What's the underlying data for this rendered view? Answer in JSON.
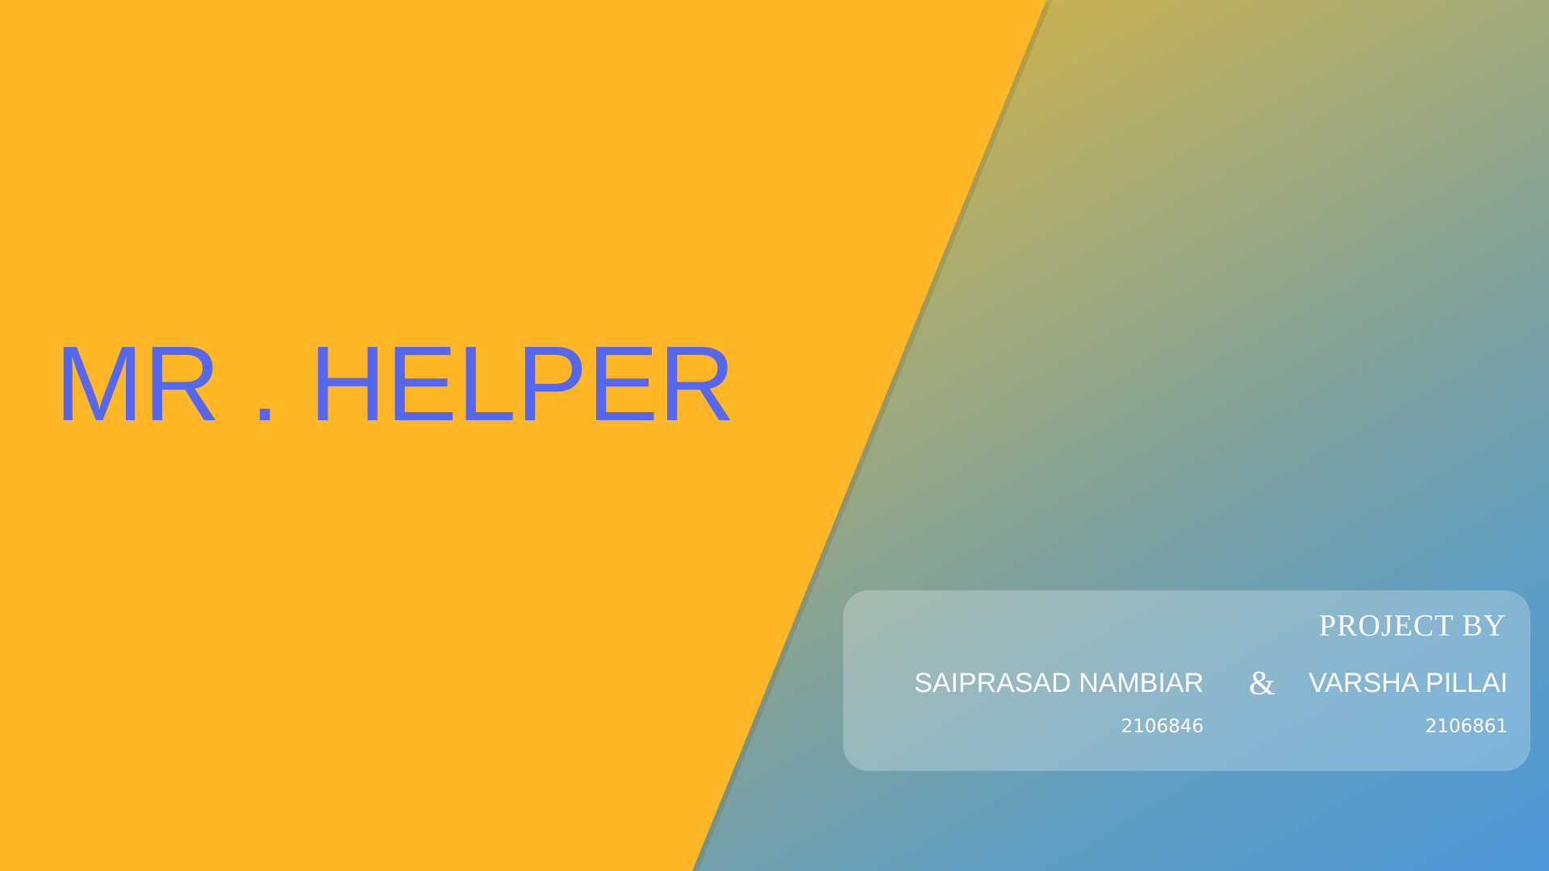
{
  "slide": {
    "title": "MR . HELPER",
    "credits": {
      "heading": "PROJECT BY",
      "separator": "&",
      "members": [
        {
          "name": "SAIPRASAD NAMBIAR",
          "id": "2106846"
        },
        {
          "name": "VARSHA PILLAI",
          "id": "2106861"
        }
      ]
    },
    "colors": {
      "left_panel": "#ffb627",
      "title": "#5566ef",
      "gradient_start": "#f6c01f",
      "gradient_end": "#4d98d8",
      "text_light": "#ffffff"
    }
  }
}
